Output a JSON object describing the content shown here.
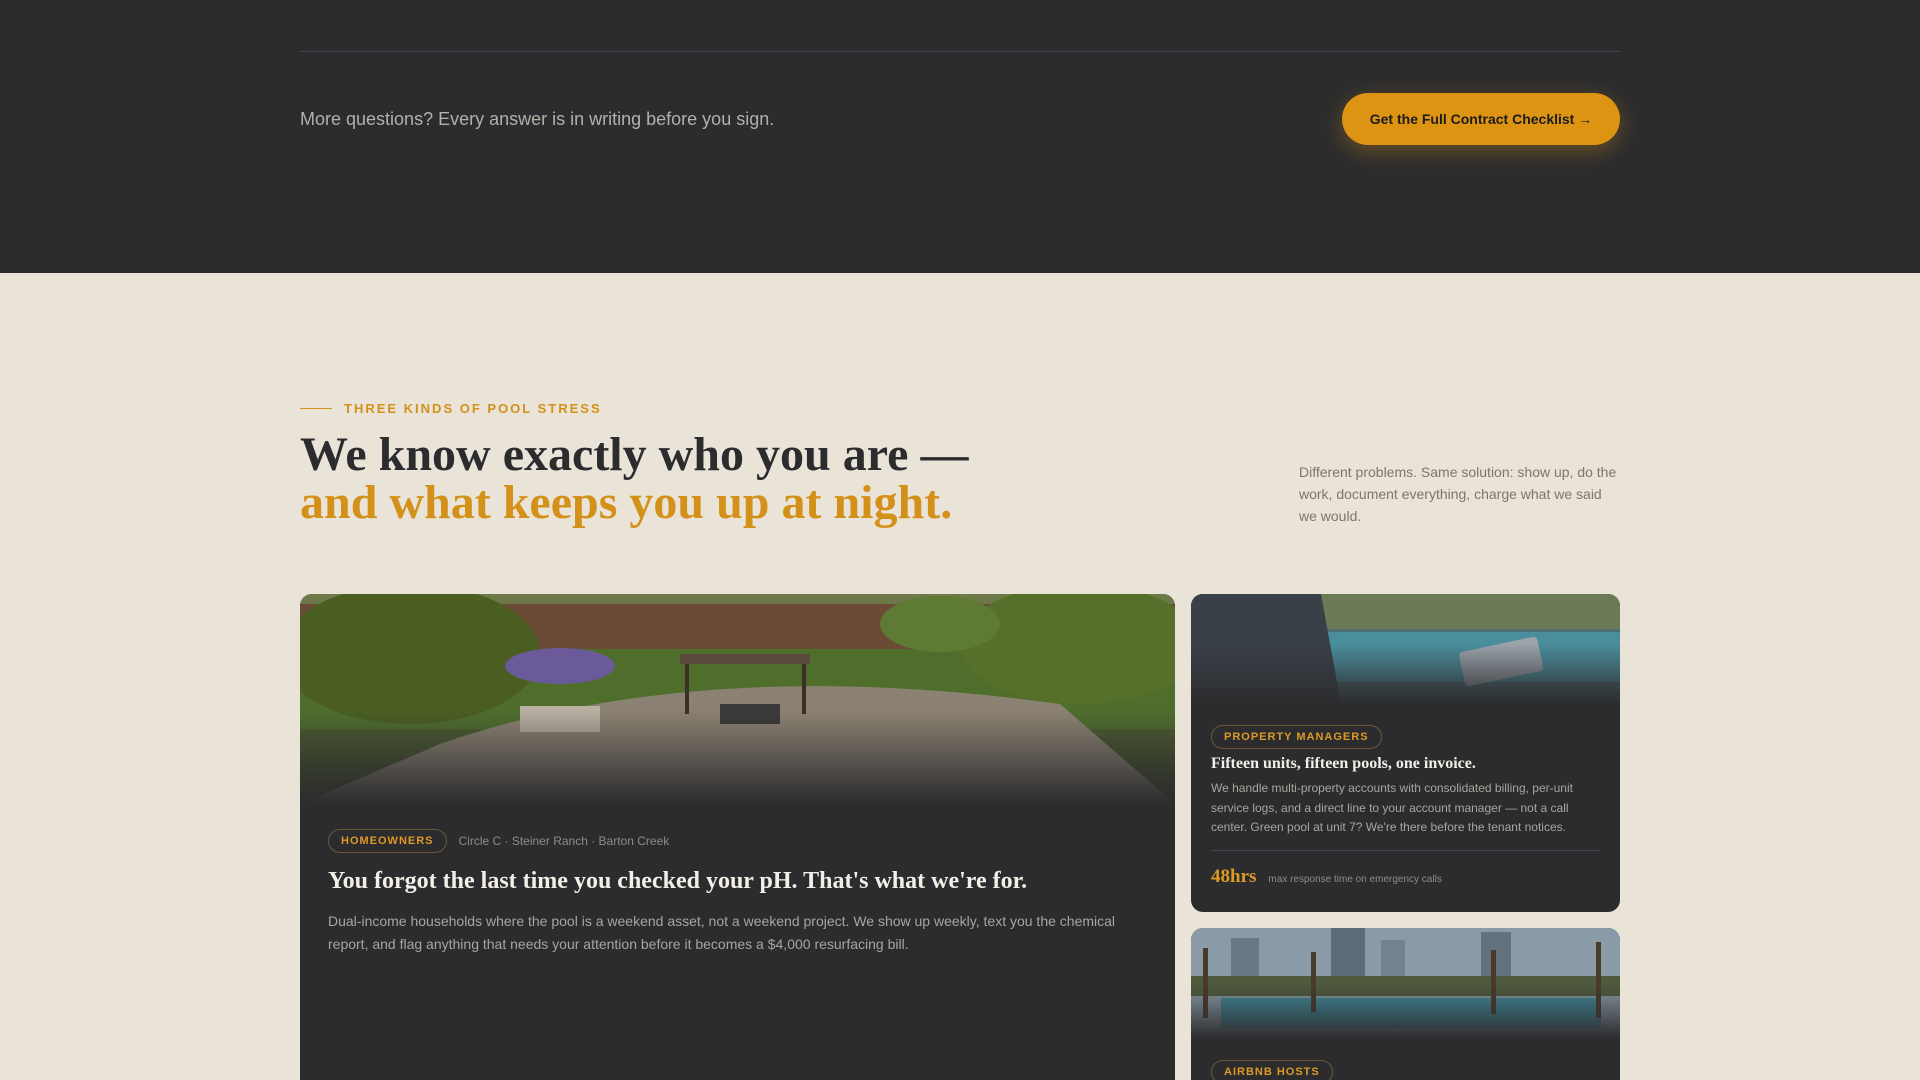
{
  "cta": {
    "text": "More questions? Every answer is in writing before you sign.",
    "button_label": "Get the Full Contract Checklist →",
    "accent_color": "#dd9412"
  },
  "section": {
    "eyebrow": "THREE KINDS OF POOL STRESS",
    "headline_line1": "We know exactly who you are —",
    "headline_line2": "and what keeps you up at night.",
    "lede": "Different problems. Same solution: show up, do the work, document everything, charge what we said we would."
  },
  "cards": {
    "homeowners": {
      "badge": "HOMEOWNERS",
      "location": "Circle C · Steiner Ranch · Barton Creek",
      "title": "You forgot the last time you checked your pH. That's what we're for.",
      "body": "Dual-income households where the pool is a weekend asset, not a weekend project. We show up weekly, text you the chemical report, and flag anything that needs your attention before it becomes a $4,000 resurfacing bill.",
      "image": "backyard-pool-pergola-photo"
    },
    "property_managers": {
      "badge": "PROPERTY MANAGERS",
      "title": "Fifteen units, fifteen pools, one invoice.",
      "body": "We handle multi-property accounts with consolidated billing, per-unit service logs, and a direct line to your account manager — not a call center. Green pool at unit 7? We're there before the tenant notices.",
      "stat_value": "48hrs",
      "stat_label": "max response time on emergency calls",
      "image": "technician-tablet-pool-photo"
    },
    "airbnb": {
      "badge": "AIRBNB HOSTS",
      "image": "rooftop-pool-skyline-photo"
    }
  },
  "colors": {
    "dark_band": "#2c2c2e",
    "cream_background": "#e9e3d8",
    "gold": "#d4911a"
  }
}
